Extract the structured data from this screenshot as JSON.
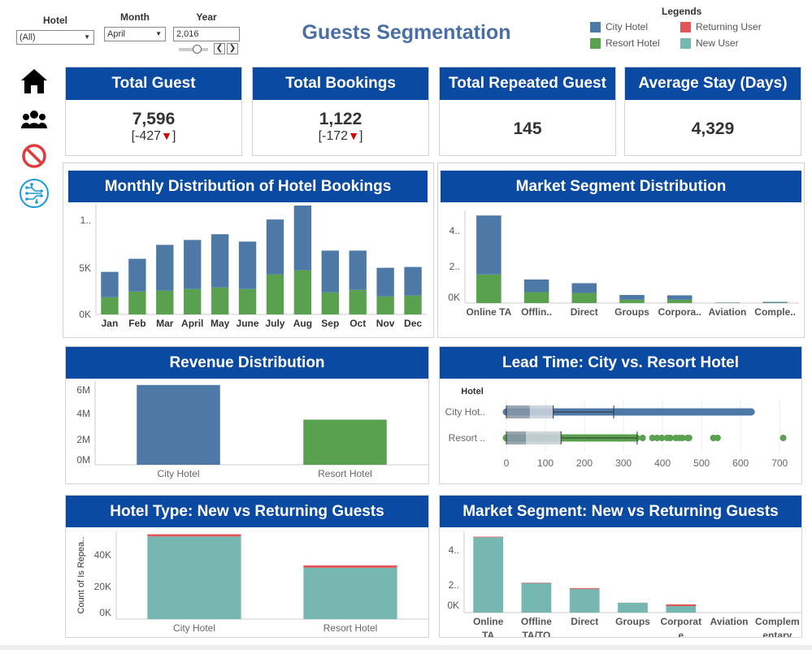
{
  "filters": {
    "hotel": {
      "label": "Hotel",
      "value": "(All)"
    },
    "month": {
      "label": "Month",
      "value": "April"
    },
    "year": {
      "label": "Year",
      "value": "2,016"
    }
  },
  "title": "Guests Segmentation",
  "legends": {
    "title": "Legends",
    "items": [
      {
        "label": "City Hotel",
        "color": "#4e79a7"
      },
      {
        "label": "Returning User",
        "color": "#e15759"
      },
      {
        "label": "Resort Hotel",
        "color": "#59a14f"
      },
      {
        "label": "New User",
        "color": "#76b7b2"
      }
    ]
  },
  "nav": [
    "home-icon",
    "users-icon",
    "ban-icon",
    "circuit-icon"
  ],
  "kpis": [
    {
      "title": "Total Guest",
      "value": "7,596",
      "delta": "[-427",
      "delta_end": "]"
    },
    {
      "title": "Total Bookings",
      "value": "1,122",
      "delta": "[-172",
      "delta_end": "]"
    },
    {
      "title": "Total Repeated Guest",
      "value": "145"
    },
    {
      "title": "Average Stay (Days)",
      "value": "4,329"
    }
  ],
  "chart_data": [
    {
      "type": "bar",
      "title": "Monthly Distribution of Hotel Bookings",
      "categories": [
        "Jan",
        "Feb",
        "Mar",
        "April",
        "May",
        "June",
        "July",
        "Aug",
        "Sep",
        "Oct",
        "Nov",
        "Dec"
      ],
      "series": [
        {
          "name": "Resort Hotel",
          "color": "#59a14f",
          "values": [
            2100,
            2800,
            2900,
            3100,
            3300,
            3100,
            4900,
            5400,
            2700,
            3000,
            2200,
            2300
          ]
        },
        {
          "name": "City Hotel",
          "color": "#4e79a7",
          "values": [
            3100,
            4000,
            5600,
            6000,
            6500,
            5800,
            6700,
            7900,
            5100,
            4800,
            3500,
            3500
          ]
        }
      ],
      "yticks": [
        "0K",
        "5K",
        "1.."
      ],
      "ylim": [
        0,
        13500
      ]
    },
    {
      "type": "bar",
      "title": "Market Segment Distribution",
      "categories": [
        "Online TA",
        "Offlin..",
        "Direct",
        "Groups",
        "Corpora..",
        "Aviation",
        "Comple.."
      ],
      "series": [
        {
          "name": "Resort Hotel",
          "color": "#59a14f",
          "values": [
            17000,
            6500,
            6000,
            2000,
            2000,
            100,
            200
          ]
        },
        {
          "name": "City Hotel",
          "color": "#4e79a7",
          "values": [
            35000,
            7500,
            5800,
            2800,
            2600,
            230,
            500
          ]
        }
      ],
      "yticks": [
        "0K",
        "2..",
        "4.."
      ],
      "ylim": [
        0,
        55000
      ]
    },
    {
      "type": "bar",
      "title": "Revenue Distribution",
      "categories": [
        "City Hotel",
        "Resort Hotel"
      ],
      "values": [
        6100000,
        3450000
      ],
      "colors": [
        "#4e79a7",
        "#59a14f"
      ],
      "yticks": [
        "0M",
        "2M",
        "4M",
        "6M"
      ],
      "ylim": [
        0,
        6400000
      ]
    },
    {
      "type": "scatter",
      "title": "Lead Time: City vs. Resort Hotel",
      "ylabel": "Hotel",
      "categories": [
        "City Hot..",
        "Resort .."
      ],
      "series": [
        {
          "name": "City Hotel",
          "color": "#4e79a7",
          "box": {
            "min": 0,
            "q1": 18,
            "median": 60,
            "q3": 120,
            "whisker": 275
          },
          "max": 629
        },
        {
          "name": "Resort Hotel",
          "color": "#59a14f",
          "box": {
            "min": 0,
            "q1": 10,
            "median": 50,
            "q3": 140,
            "whisker": 335
          },
          "outliers": [
            349,
            374,
            386,
            398,
            412,
            420,
            434,
            443,
            451,
            464,
            468,
            530,
            541,
            709
          ]
        }
      ],
      "xticks": [
        "0",
        "100",
        "200",
        "300",
        "400",
        "500",
        "600",
        "700"
      ],
      "xlim": [
        0,
        737
      ]
    },
    {
      "type": "bar",
      "title": "Hotel Type: New vs Returning Guests",
      "ylabel": "Count of Is Repea..",
      "categories": [
        "City Hotel",
        "Resort Hotel"
      ],
      "series": [
        {
          "name": "New User",
          "color": "#76b7b2",
          "values": [
            51800,
            32200
          ]
        },
        {
          "name": "Returning User",
          "color": "#e15759",
          "values": [
            1400,
            1500
          ]
        }
      ],
      "yticks": [
        "0K",
        "20K",
        "40K"
      ],
      "ylim": [
        0,
        55000
      ]
    },
    {
      "type": "bar",
      "title": "Market Segment: New vs Returning Guests",
      "categories": [
        "Online TA",
        "Offline TA/TO",
        "Direct",
        "Groups",
        "Corporat e",
        "Aviation",
        "Complem entary"
      ],
      "series": [
        {
          "name": "New User",
          "color": "#76b7b2",
          "values": [
            51000,
            20000,
            16000,
            6600,
            4400,
            0,
            0
          ]
        },
        {
          "name": "Returning User",
          "color": "#e15759",
          "values": [
            400,
            300,
            600,
            100,
            1200,
            0,
            0
          ]
        }
      ],
      "yticks": [
        "0K",
        "2..",
        "4.."
      ],
      "ylim": [
        0,
        55000
      ]
    }
  ]
}
